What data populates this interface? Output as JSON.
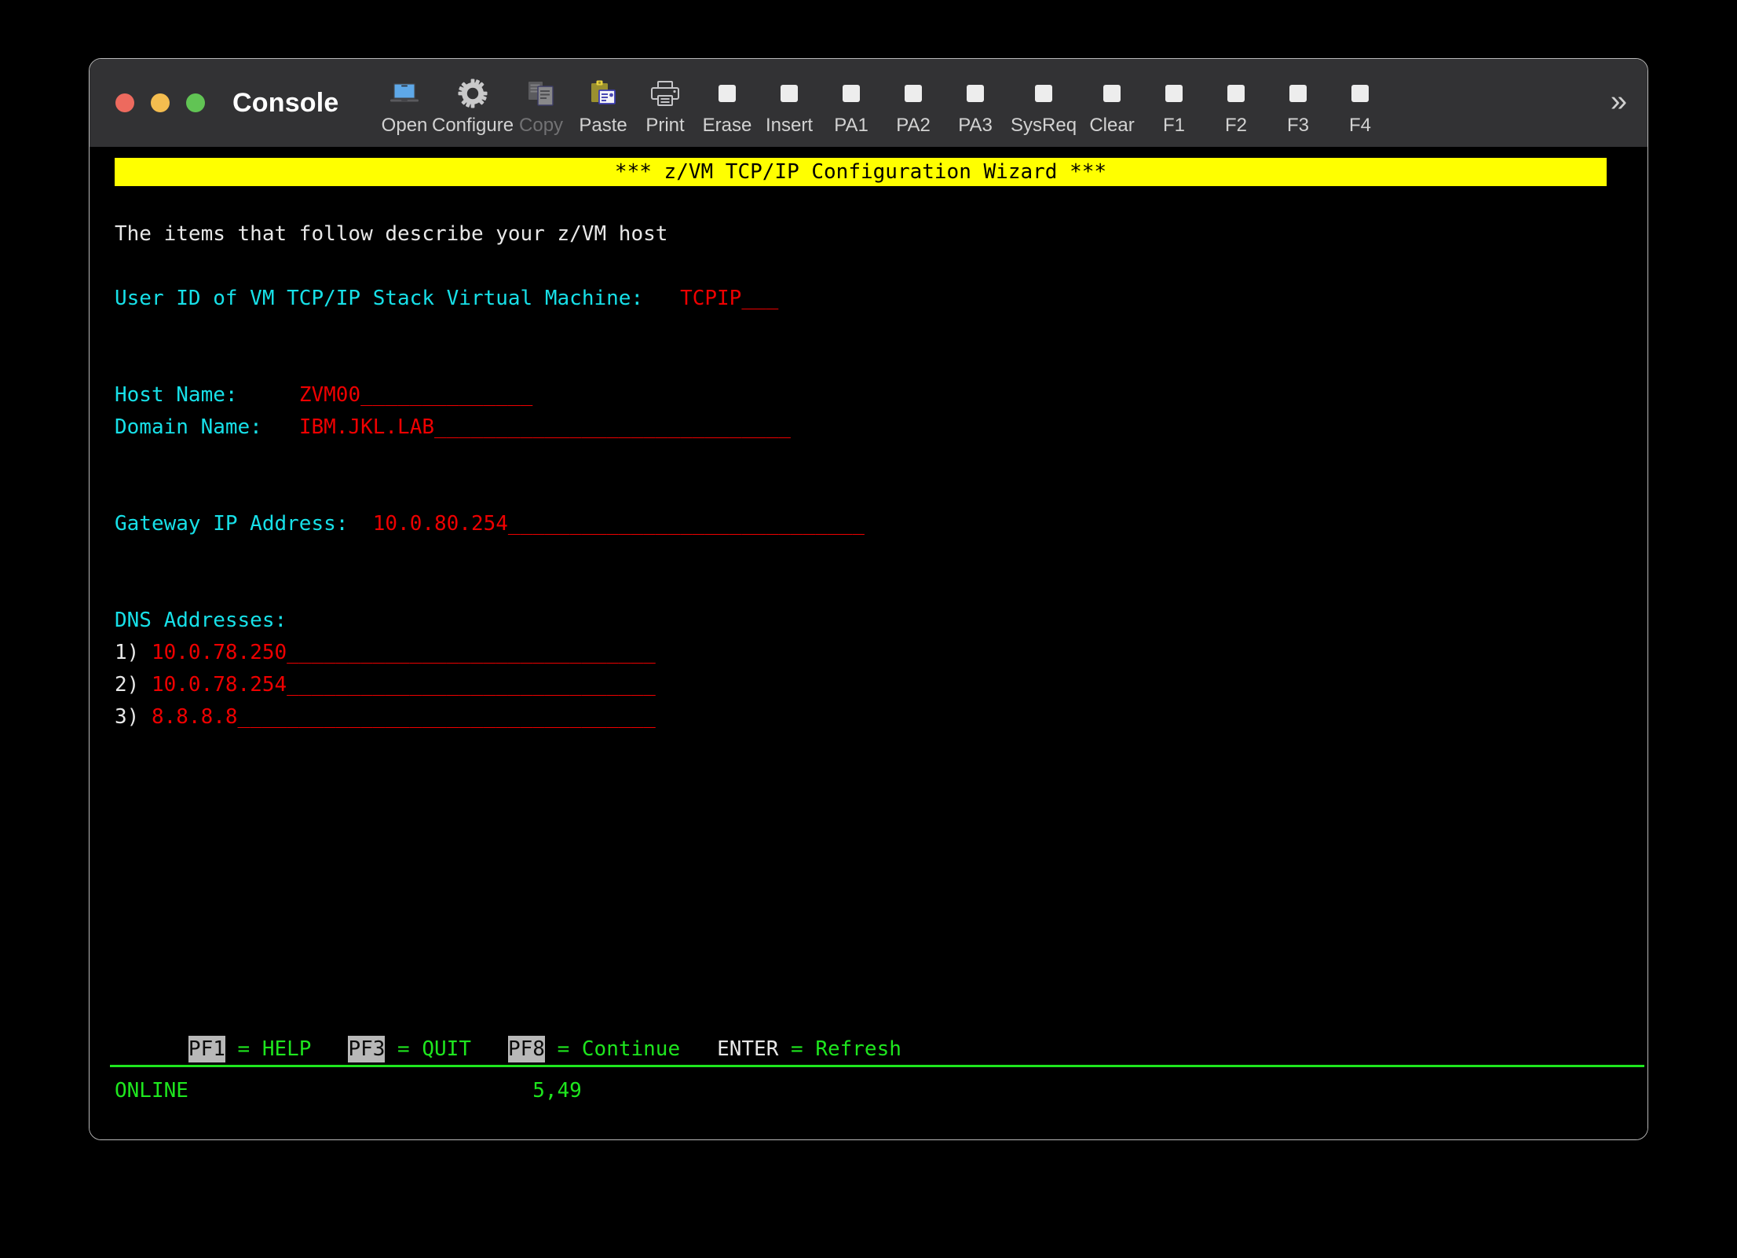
{
  "window": {
    "title": "Console",
    "traffic_lights": [
      {
        "name": "close",
        "color": "#ed6a5e"
      },
      {
        "name": "minimize",
        "color": "#f4bd4f"
      },
      {
        "name": "maximize",
        "color": "#61c454"
      }
    ]
  },
  "toolbar": {
    "items": [
      {
        "label": "Open",
        "icon": "laptop-icon",
        "disabled": false
      },
      {
        "label": "Configure",
        "icon": "gear-icon",
        "disabled": false
      },
      {
        "label": "Copy",
        "icon": "copy-icon",
        "disabled": true
      },
      {
        "label": "Paste",
        "icon": "clipboard-icon",
        "disabled": false
      },
      {
        "label": "Print",
        "icon": "printer-icon",
        "disabled": false
      },
      {
        "label": "Erase",
        "icon": "key-square-icon",
        "disabled": false
      },
      {
        "label": "Insert",
        "icon": "key-square-icon",
        "disabled": false
      },
      {
        "label": "PA1",
        "icon": "key-square-icon",
        "disabled": false
      },
      {
        "label": "PA2",
        "icon": "key-square-icon",
        "disabled": false
      },
      {
        "label": "PA3",
        "icon": "key-square-icon",
        "disabled": false
      },
      {
        "label": "SysReq",
        "icon": "key-square-icon",
        "disabled": false
      },
      {
        "label": "Clear",
        "icon": "key-square-icon",
        "disabled": false
      },
      {
        "label": "F1",
        "icon": "key-square-icon",
        "disabled": false
      },
      {
        "label": "F2",
        "icon": "key-square-icon",
        "disabled": false
      },
      {
        "label": "F3",
        "icon": "key-square-icon",
        "disabled": false
      },
      {
        "label": "F4",
        "icon": "key-square-icon",
        "disabled": false
      }
    ],
    "overflow_label": "»"
  },
  "terminal": {
    "banner": "*** z/VM TCP/IP Configuration Wizard ***",
    "intro": "The items that follow describe your z/VM host",
    "userid": {
      "label": "User ID of VM TCP/IP Stack Virtual Machine:",
      "gap": "   ",
      "value": "TCPIP",
      "fill": "___"
    },
    "hostname": {
      "label": "Host Name:",
      "gap": "     ",
      "value": "ZVM00",
      "fill": "______________"
    },
    "domain": {
      "label": "Domain Name:",
      "gap": "   ",
      "value": "IBM.JKL.LAB",
      "fill": "_____________________________"
    },
    "gateway": {
      "label": "Gateway IP Address:",
      "gap": "  ",
      "value": "10.0.80.254",
      "fill": "_____________________________"
    },
    "dns": {
      "heading": "DNS Addresses:",
      "entries": [
        {
          "index": "1)",
          "gap": " ",
          "value": "10.0.78.250",
          "fill": "______________________________"
        },
        {
          "index": "2)",
          "gap": " ",
          "value": "10.0.78.254",
          "fill": "______________________________"
        },
        {
          "index": "3)",
          "gap": " ",
          "value": "8.8.8.8",
          "fill": "__________________________________"
        }
      ]
    },
    "pfkeys": {
      "pf1_key": "PF1",
      "pf1_text": " = HELP   ",
      "pf3_key": "PF3",
      "pf3_text": " = QUIT   ",
      "pf8_key": "PF8",
      "pf8_text": " = Continue   ",
      "enter_key": "ENTER",
      "enter_text": " = Refresh"
    },
    "status": {
      "state": "ONLINE",
      "spacer": "                            ",
      "cursor_position": "5,49"
    }
  },
  "colors": {
    "banner_bg": "#ffff00",
    "banner_fg": "#000000",
    "label": "#17e0e8",
    "value": "#ee0000",
    "plain": "#e8e8e8",
    "status": "#1ee61e",
    "chrome": "#323234"
  }
}
